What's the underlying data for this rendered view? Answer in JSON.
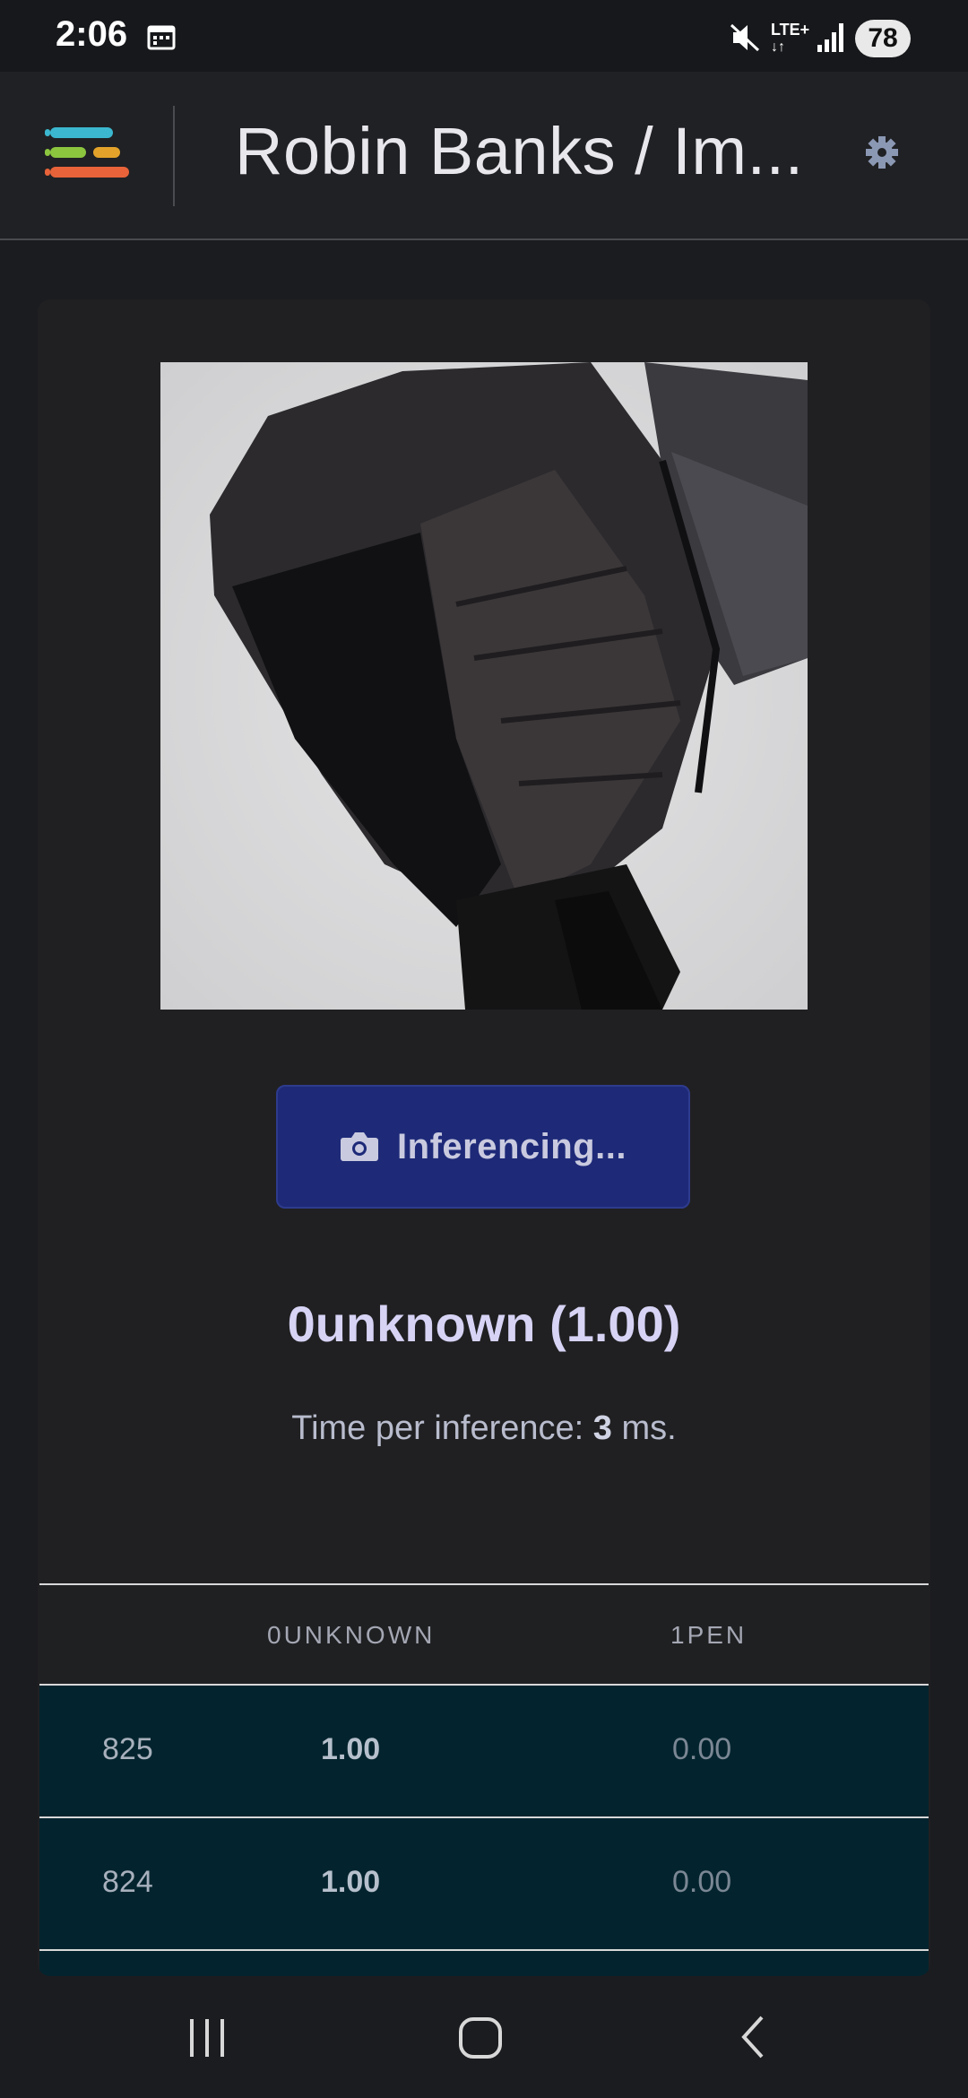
{
  "status_bar": {
    "time": "2:06",
    "network": "LTE+",
    "battery": "78"
  },
  "header": {
    "title": "Robin Banks / Im..."
  },
  "main": {
    "button_label": "Inferencing...",
    "result": "0unknown (1.00)",
    "timing_prefix": "Time per inference: ",
    "timing_value": "3",
    "timing_suffix": " ms."
  },
  "table": {
    "headers": [
      "",
      "0UNKNOWN",
      "1PEN"
    ],
    "rows": [
      [
        "825",
        "1.00",
        "0.00"
      ],
      [
        "824",
        "1.00",
        "0.00"
      ]
    ]
  },
  "colors": {
    "accent_button": "#1e2a78",
    "row_background": "#03242e",
    "logo_cyan": "#3bb8cf",
    "logo_green": "#8cc63f",
    "logo_orange": "#e8633a"
  },
  "icons": [
    "calendar-icon",
    "mute-icon",
    "signal-icon",
    "logo-icon",
    "gear-icon",
    "camera-icon",
    "recents-icon",
    "home-icon",
    "back-icon"
  ]
}
